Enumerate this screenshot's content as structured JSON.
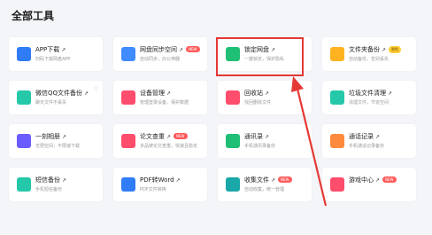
{
  "title": "全部工具",
  "tools": [
    {
      "name": "APP下载",
      "desc": "扫码下载网盘APP",
      "badge": "",
      "icon": "phone-icon",
      "color": "#2f7cf6"
    },
    {
      "name": "网盘同步空间",
      "desc": "自动同步，办公神器",
      "badge": "NEW",
      "icon": "sync-diamond-icon",
      "color": "#3f8bff"
    },
    {
      "name": "锁定网盘",
      "desc": "一键锁定，保护隐私",
      "badge": "",
      "icon": "lock-icon",
      "color": "#1fbf75"
    },
    {
      "name": "文件夹备份",
      "desc": "自动备份，告别丢失",
      "badge": "限免",
      "icon": "folder-icon",
      "color": "#ffb21f"
    },
    {
      "name": "微信QQ文件备份",
      "desc": "聊天文件不丢失",
      "badge": "",
      "icon": "chat-bubble-icon",
      "color": "#25c8a8"
    },
    {
      "name": "设备管理",
      "desc": "管理登录设备，保护数据",
      "badge": "",
      "icon": "device-icon",
      "color": "#ff4d6d"
    },
    {
      "name": "回收站",
      "desc": "找回删除文件",
      "badge": "",
      "icon": "trash-icon",
      "color": "#ff4d6d"
    },
    {
      "name": "垃圾文件清理",
      "desc": "清理文件，节省空间",
      "badge": "",
      "icon": "broom-icon",
      "color": "#25c8a8"
    },
    {
      "name": "一刻相册",
      "desc": "无限空间，不限速下载",
      "badge": "",
      "icon": "album-icon",
      "color": "#6a5cff"
    },
    {
      "name": "论文查重",
      "desc": "多品牌论文查重，快速且稳定",
      "badge": "NEW",
      "icon": "paper-check-icon",
      "color": "#ff4d6d"
    },
    {
      "name": "通讯录",
      "desc": "手机通讯录备份",
      "badge": "",
      "icon": "contacts-icon",
      "color": "#1fbf75"
    },
    {
      "name": "通话记录",
      "desc": "手机通话记录备份",
      "badge": "",
      "icon": "phone-call-icon",
      "color": "#ff8a3d"
    },
    {
      "name": "短信备份",
      "desc": "手机短信备份",
      "badge": "",
      "icon": "sms-icon",
      "color": "#25c8a8"
    },
    {
      "name": "PDF转Word",
      "desc": "PDF文件转换",
      "badge": "",
      "icon": "pdf-icon",
      "color": "#2f7cf6"
    },
    {
      "name": "收集文件",
      "desc": "自动收集，统一管理",
      "badge": "NEW",
      "icon": "collect-icon",
      "color": "#1aa7a7"
    },
    {
      "name": "游戏中心",
      "desc": "",
      "badge": "NEW",
      "icon": "game-icon",
      "color": "#ff4d6d"
    }
  ]
}
